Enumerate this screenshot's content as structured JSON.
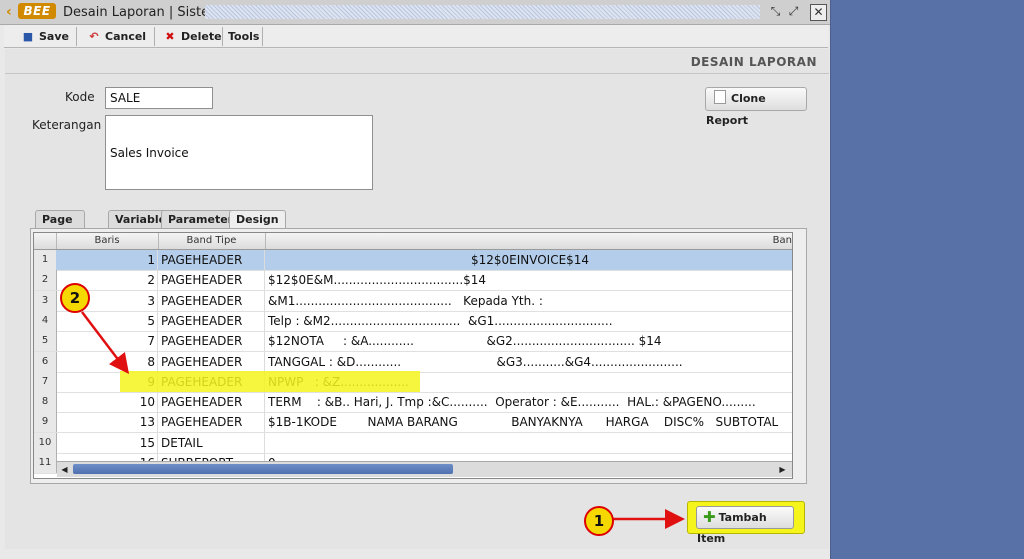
{
  "window": {
    "title": "Desain Laporan | Sistem",
    "logo": "BEE"
  },
  "toolbar": {
    "save": "Save",
    "cancel": "Cancel",
    "delete": "Delete",
    "tools": "Tools"
  },
  "header": {
    "title": "DESAIN LAPORAN"
  },
  "form": {
    "kode_label": "Kode",
    "kode_value": "SALE",
    "keterangan_label": "Keterangan",
    "keterangan_value": "Sales Invoice",
    "clone_button": "Clone Report"
  },
  "tabs": [
    "Page Setup",
    "Variable",
    "Parameter",
    "Design Layout"
  ],
  "grid": {
    "columns": [
      "Baris",
      "Band Tipe",
      "Ban"
    ],
    "rows": [
      {
        "n": "1",
        "baris": "1",
        "band": "PAGEHEADER",
        "text": "$12$0EINVOICE$14"
      },
      {
        "n": "2",
        "baris": "2",
        "band": "PAGEHEADER",
        "text": "$12$0E&M..................................$14"
      },
      {
        "n": "3",
        "baris": "3",
        "band": "PAGEHEADER",
        "text": "&M1.........................................   Kepada Yth. :"
      },
      {
        "n": "4",
        "baris": "5",
        "band": "PAGEHEADER",
        "text": "Telp : &M2..................................  &G1..............................."
      },
      {
        "n": "5",
        "baris": "7",
        "band": "PAGEHEADER",
        "text": "$12NOTA     : &A............                   &G2................................ $14"
      },
      {
        "n": "6",
        "baris": "8",
        "band": "PAGEHEADER",
        "text": "TANGGAL : &D............                         &G3...........&G4........................"
      },
      {
        "n": "7",
        "baris": "9",
        "band": "PAGEHEADER",
        "text": "NPWP   : &Z.................."
      },
      {
        "n": "8",
        "baris": "10",
        "band": "PAGEHEADER",
        "text": "TERM    : &B.. Hari, J. Tmp :&C..........  Operator : &E...........  HAL.: &PAGENO........."
      },
      {
        "n": "9",
        "baris": "13",
        "band": "PAGEHEADER",
        "text": "$1B-1KODE        NAMA BARANG              BANYAKNYA      HARGA    DISC%   SUBTOTAL"
      },
      {
        "n": "10",
        "baris": "15",
        "band": "DETAIL",
        "text": ""
      },
      {
        "n": "11",
        "baris": "16",
        "band": "SUBREPORT",
        "text": "0"
      }
    ]
  },
  "tambah_button": "Tambah Item",
  "annotations": {
    "one": "1",
    "two": "2"
  },
  "colors": {
    "highlight": "#f5f51c",
    "selection": "#b4cdea",
    "arrow": "#e01010",
    "desktop": "#5872a8"
  }
}
